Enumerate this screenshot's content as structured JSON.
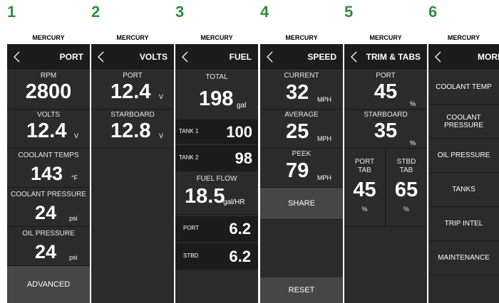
{
  "brand": "MERCURY",
  "steps": [
    "1",
    "2",
    "3",
    "4",
    "5",
    "6"
  ],
  "port": {
    "title": "PORT",
    "rpm_label": "RPM",
    "rpm_value": "2800",
    "volts_label": "VOLTS",
    "volts_value": "12.4",
    "volts_unit": "V",
    "coolant_temps_label": "COOLANT TEMPS",
    "coolant_temps_value": "143",
    "coolant_temps_unit": "°F",
    "coolant_pressure_label": "COOLANT PRESSURE",
    "coolant_pressure_value": "24",
    "coolant_pressure_unit": "psi",
    "oil_pressure_label": "OIL PRESSURE",
    "oil_pressure_value": "24",
    "oil_pressure_unit": "psi",
    "advanced_label": "ADVANCED"
  },
  "volts": {
    "title": "VOLTS",
    "port_label": "PORT",
    "port_value": "12.4",
    "port_unit": "V",
    "starboard_label": "STARBOARD",
    "starboard_value": "12.8",
    "starboard_unit": "V"
  },
  "fuel": {
    "title": "FUEL",
    "total_label": "TOTAL",
    "total_value": "198",
    "total_unit": "gal",
    "tank1_label": "TANK 1",
    "tank1_value": "100",
    "tank2_label": "TANK 2",
    "tank2_value": "98",
    "flow_label": "FUEL FLOW",
    "flow_value": "18.5",
    "flow_unit": "gal/HR",
    "port_label": "PORT",
    "port_value": "6.2",
    "stbd_label": "STBD",
    "stbd_value": "6.2"
  },
  "speed": {
    "title": "SPEED",
    "current_label": "CURRENT",
    "current_value": "32",
    "current_unit": "MPH",
    "average_label": "AVERAGE",
    "average_value": "25",
    "average_unit": "MPH",
    "peek_label": "PEEK",
    "peek_value": "79",
    "peek_unit": "MPH",
    "share_label": "SHARE",
    "reset_label": "RESET"
  },
  "trim": {
    "title": "TRIM & TABS",
    "port_label": "PORT",
    "port_value": "45",
    "port_unit": "%",
    "starboard_label": "STARBOARD",
    "starboard_value": "35",
    "starboard_unit": "%",
    "port_tab_label_1": "PORT",
    "port_tab_label_2": "TAB",
    "port_tab_value": "45",
    "port_tab_unit": "%",
    "stbd_tab_label_1": "STBD",
    "stbd_tab_label_2": "TAB",
    "stbd_tab_value": "65",
    "stbd_tab_unit": "%"
  },
  "more": {
    "title": "MORE",
    "items": [
      "COOLANT TEMP",
      "COOLANT PRESSURE",
      "OIL PRESSURE",
      "TANKS",
      "TRIP INTEL",
      "MAINTENANCE"
    ]
  }
}
